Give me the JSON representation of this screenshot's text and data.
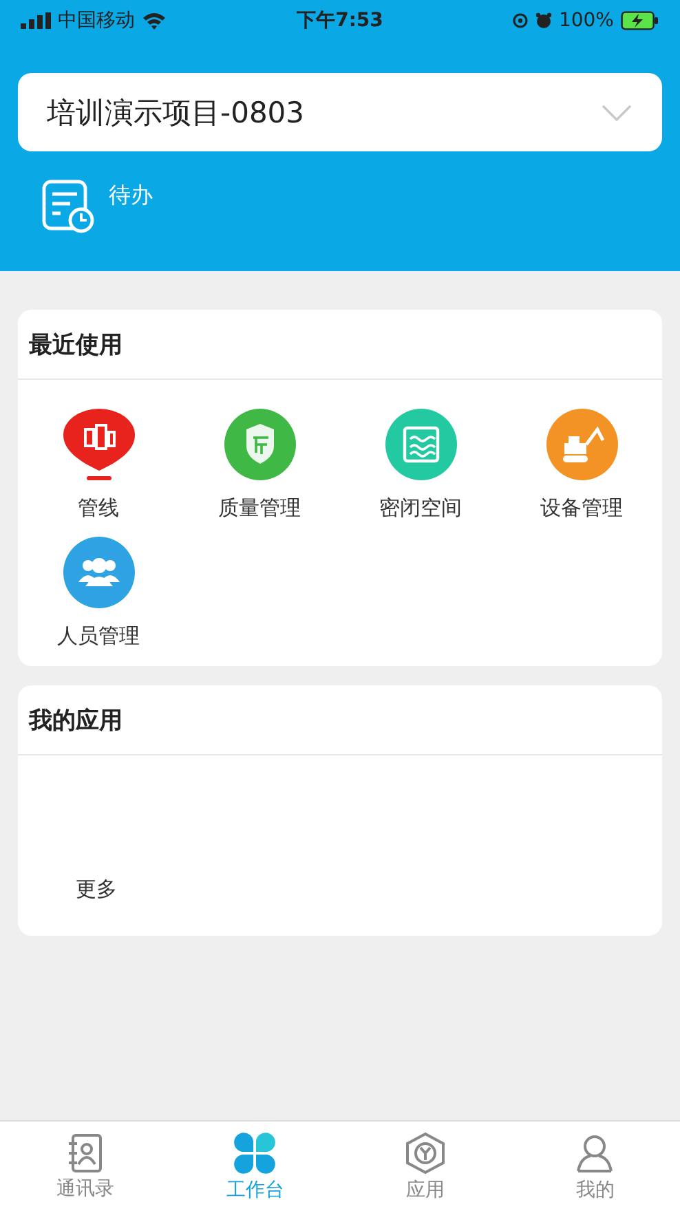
{
  "status_bar": {
    "carrier": "中国移动",
    "time": "下午7:53",
    "battery": "100%"
  },
  "project_select": {
    "value": "培训演示项目-0803"
  },
  "shortcut": {
    "label": "待办"
  },
  "recent": {
    "title": "最近使用",
    "apps": [
      {
        "label": "管线",
        "kind": "pipeline",
        "color": "#e8231e"
      },
      {
        "label": "质量管理",
        "kind": "quality",
        "color": "#3fb845"
      },
      {
        "label": "密闭空间",
        "kind": "space",
        "color": "#23c9a0"
      },
      {
        "label": "设备管理",
        "kind": "equipment",
        "color": "#f39325"
      },
      {
        "label": "人员管理",
        "kind": "people",
        "color": "#2fa2e3"
      }
    ]
  },
  "my_apps": {
    "title": "我的应用",
    "more": "更多"
  },
  "tabs": [
    {
      "label": "通讯录",
      "kind": "contacts",
      "selected": false
    },
    {
      "label": "工作台",
      "kind": "workbench",
      "selected": true
    },
    {
      "label": "应用",
      "kind": "apps",
      "selected": false
    },
    {
      "label": "我的",
      "kind": "me",
      "selected": false
    }
  ]
}
